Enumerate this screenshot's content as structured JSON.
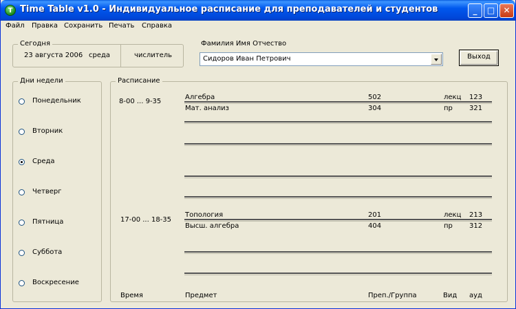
{
  "window": {
    "title": "Time Table v1.0 - Индивидуальное расписание для преподавателей и студентов"
  },
  "menu": [
    "Файл",
    "Правка",
    "Сохранить",
    "Печать",
    "Справка"
  ],
  "today": {
    "label": "Сегодня",
    "date": "23 августа 2006",
    "weekday": "среда",
    "week_type": "числитель"
  },
  "name_field": {
    "label": "Фамилия Имя Отчество",
    "value": "Сидоров Иван Петрович"
  },
  "exit_button": "Выход",
  "days": {
    "label": "Дни недели",
    "items": [
      "Понедельник",
      "Вторник",
      "Среда",
      "Четверг",
      "Пятница",
      "Суббота",
      "Воскресение"
    ],
    "selected": "Среда"
  },
  "schedule": {
    "label": "Расписание",
    "slots": [
      {
        "time": "8-00 ... 9-35",
        "rows": [
          {
            "subject": "Алгебра",
            "group": "502",
            "type": "лекц",
            "room": "123"
          },
          {
            "subject": "Мат. анализ",
            "group": "304",
            "type": "пр",
            "room": "321"
          }
        ]
      },
      {
        "time": "17-00 ... 18-35",
        "rows": [
          {
            "subject": "Топология",
            "group": "201",
            "type": "лекц",
            "room": "213"
          },
          {
            "subject": "Высш. алгебра",
            "group": "404",
            "type": "пр",
            "room": "312"
          }
        ]
      }
    ],
    "headers": {
      "time": "Время",
      "subject": "Предмет",
      "teacher_group": "Преп./Группа",
      "type": "Вид",
      "room": "ауд"
    }
  }
}
